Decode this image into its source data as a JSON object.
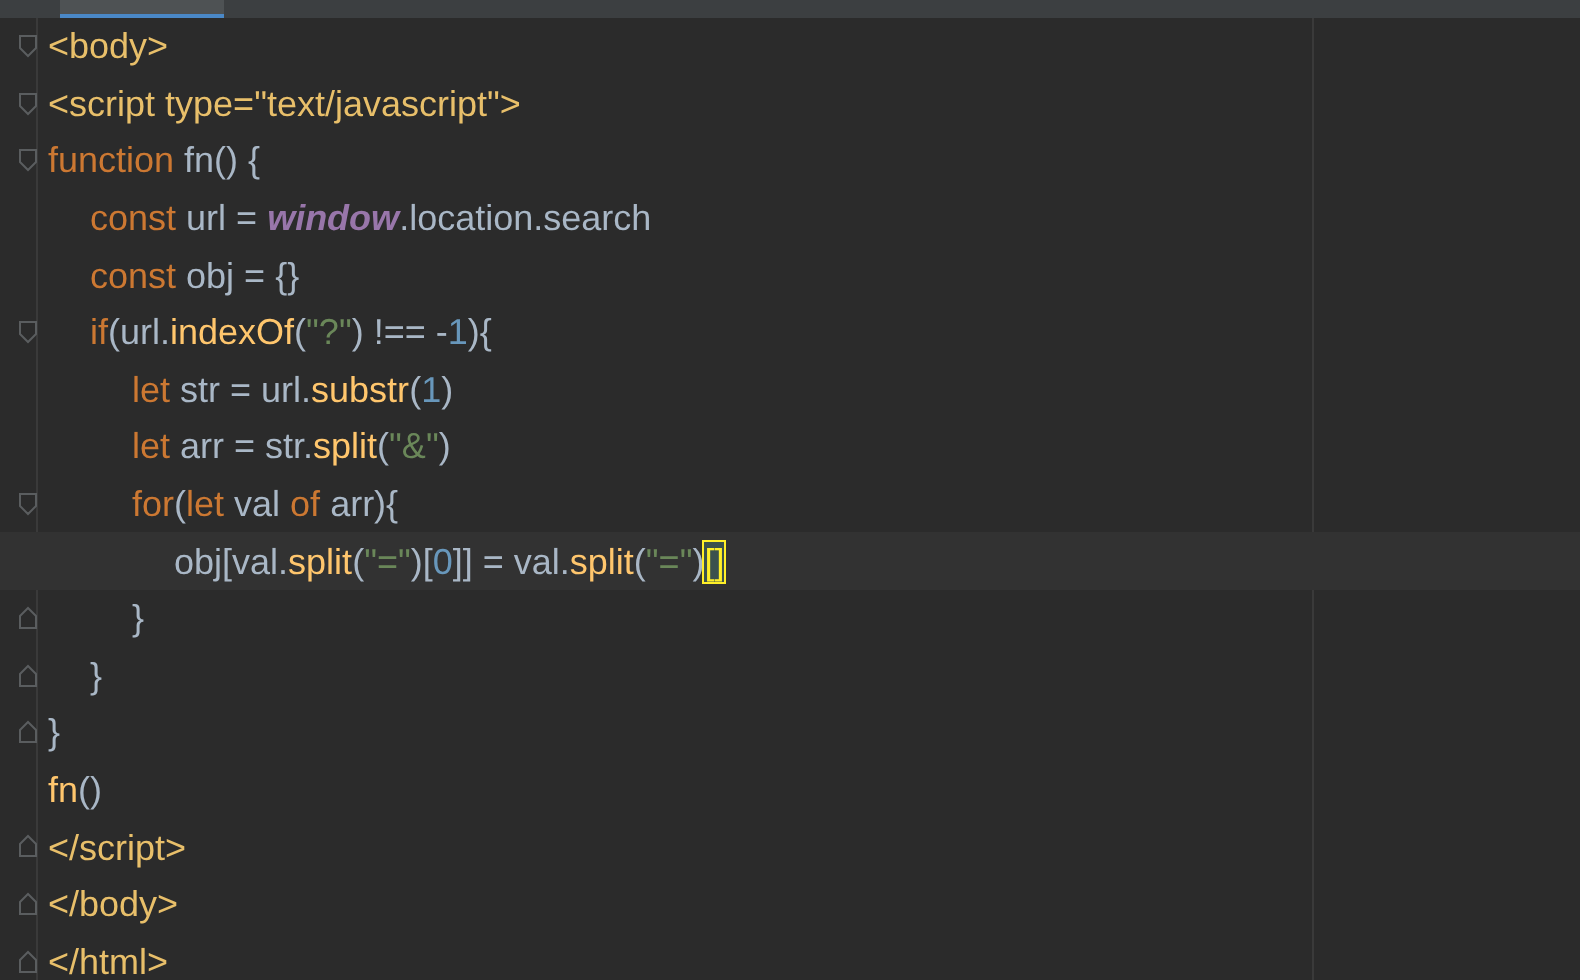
{
  "editor": {
    "lines": [
      {
        "kind": "block-start",
        "current": false,
        "tokens": [
          {
            "t": "<body>",
            "kind": "tag"
          }
        ]
      },
      {
        "kind": "block-start",
        "current": false,
        "tokens": [
          {
            "t": "<script ",
            "kind": "tag"
          },
          {
            "t": "type=",
            "kind": "tag"
          },
          {
            "t": "\"text/javascript\"",
            "kind": "tag"
          },
          {
            "t": ">",
            "kind": "tag"
          }
        ]
      },
      {
        "kind": "block-start",
        "current": false,
        "tokens": [
          {
            "t": "function ",
            "kind": "keyword"
          },
          {
            "t": "fn() {",
            "kind": "plain"
          }
        ],
        "children": [
          {
            "current": false,
            "tokens": [
              {
                "t": "const ",
                "kind": "keyword"
              },
              {
                "t": "url = ",
                "kind": "plain"
              },
              {
                "t": "window",
                "kind": "global"
              },
              {
                "t": ".location.search",
                "kind": "plain"
              }
            ]
          },
          {
            "current": false,
            "tokens": [
              {
                "t": "const ",
                "kind": "keyword"
              },
              {
                "t": "obj = {}",
                "kind": "plain"
              }
            ]
          },
          {
            "kind": "block-start",
            "current": false,
            "tokens": [
              {
                "t": "if",
                "kind": "keyword"
              },
              {
                "t": "(url.",
                "kind": "plain"
              },
              {
                "t": "indexOf",
                "kind": "method"
              },
              {
                "t": "(",
                "kind": "plain"
              },
              {
                "t": "\"?\"",
                "kind": "string"
              },
              {
                "t": ") !== -",
                "kind": "plain"
              },
              {
                "t": "1",
                "kind": "number"
              },
              {
                "t": "){",
                "kind": "plain"
              }
            ],
            "children": [
              {
                "current": false,
                "tokens": [
                  {
                    "t": "let ",
                    "kind": "keyword"
                  },
                  {
                    "t": "str = url.",
                    "kind": "plain"
                  },
                  {
                    "t": "substr",
                    "kind": "method"
                  },
                  {
                    "t": "(",
                    "kind": "plain"
                  },
                  {
                    "t": "1",
                    "kind": "number"
                  },
                  {
                    "t": ")",
                    "kind": "plain"
                  }
                ]
              },
              {
                "current": false,
                "tokens": [
                  {
                    "t": "let ",
                    "kind": "keyword"
                  },
                  {
                    "t": "arr = str.",
                    "kind": "plain"
                  },
                  {
                    "t": "split",
                    "kind": "method"
                  },
                  {
                    "t": "(",
                    "kind": "plain"
                  },
                  {
                    "t": "\"&\"",
                    "kind": "string"
                  },
                  {
                    "t": ")",
                    "kind": "plain"
                  }
                ]
              },
              {
                "kind": "block-start",
                "current": false,
                "tokens": [
                  {
                    "t": "for",
                    "kind": "keyword"
                  },
                  {
                    "t": "(",
                    "kind": "plain"
                  },
                  {
                    "t": "let ",
                    "kind": "keyword"
                  },
                  {
                    "t": "val ",
                    "kind": "plain"
                  },
                  {
                    "t": "of ",
                    "kind": "keyword"
                  },
                  {
                    "t": "arr){",
                    "kind": "plain"
                  }
                ],
                "children": [
                  {
                    "current": true,
                    "tokens": [
                      {
                        "t": "obj[val.",
                        "kind": "plain"
                      },
                      {
                        "t": "split",
                        "kind": "method"
                      },
                      {
                        "t": "(",
                        "kind": "plain"
                      },
                      {
                        "t": "\"=\"",
                        "kind": "string"
                      },
                      {
                        "t": ")[",
                        "kind": "plain"
                      },
                      {
                        "t": "0",
                        "kind": "number"
                      },
                      {
                        "t": "]] = val.",
                        "kind": "plain"
                      },
                      {
                        "t": "split",
                        "kind": "method"
                      },
                      {
                        "t": "(",
                        "kind": "plain"
                      },
                      {
                        "t": "\"=\"",
                        "kind": "string"
                      },
                      {
                        "t": ")",
                        "kind": "plain"
                      },
                      {
                        "t": "[]",
                        "kind": "matched"
                      }
                    ]
                  }
                ]
              },
              {
                "kind": "block-end",
                "current": false,
                "tokens": [
                  {
                    "t": "}",
                    "kind": "plain"
                  }
                ]
              }
            ]
          },
          {
            "kind": "block-end",
            "current": false,
            "tokens": [
              {
                "t": "}",
                "kind": "plain"
              }
            ]
          }
        ]
      },
      {
        "kind": "block-end",
        "current": false,
        "tokens": [
          {
            "t": "}",
            "kind": "plain"
          }
        ]
      },
      {
        "current": false,
        "tokens": [
          {
            "t": "fn",
            "kind": "method"
          },
          {
            "t": "()",
            "kind": "plain"
          }
        ]
      },
      {
        "kind": "block-end",
        "current": false,
        "tokens": [
          {
            "t": "</script>",
            "kind": "tag"
          }
        ]
      },
      {
        "kind": "block-end",
        "current": false,
        "tokens": [
          {
            "t": "</body>",
            "kind": "tag"
          }
        ]
      },
      {
        "kind": "block-end",
        "current": false,
        "tokens": [
          {
            "t": "</html>",
            "kind": "tag"
          }
        ]
      }
    ]
  }
}
